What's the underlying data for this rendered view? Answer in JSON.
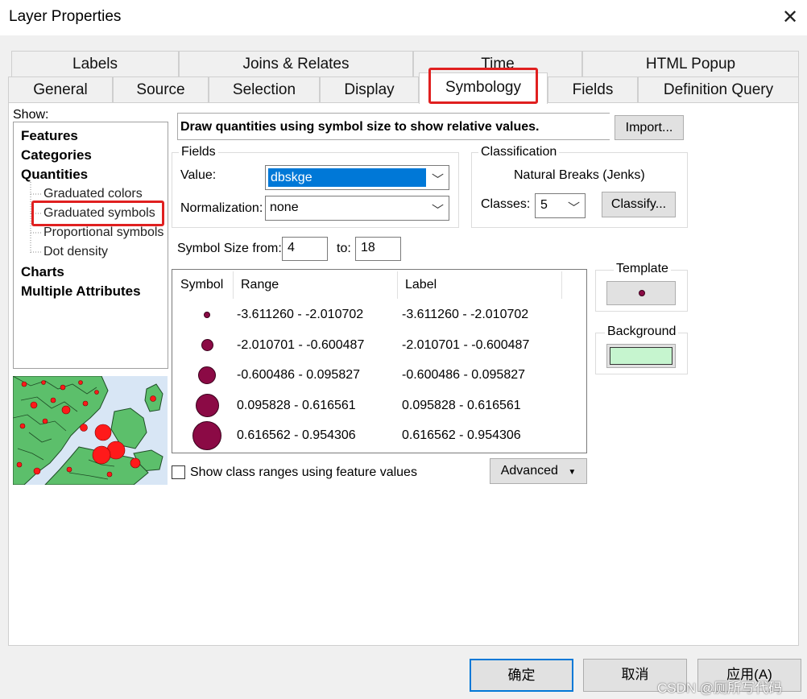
{
  "window": {
    "title": "Layer Properties",
    "close_glyph": "✕"
  },
  "tabs": {
    "row1": [
      "Labels",
      "Joins & Relates",
      "Time",
      "HTML Popup"
    ],
    "row2": [
      "General",
      "Source",
      "Selection",
      "Display",
      "Symbology",
      "Fields",
      "Definition Query"
    ],
    "active": "Symbology"
  },
  "show_panel": {
    "label": "Show:",
    "items": [
      "Features",
      "Categories",
      "Quantities"
    ],
    "sub_items": [
      "Graduated colors",
      "Graduated symbols",
      "Proportional symbols",
      "Dot density"
    ],
    "items_after": [
      "Charts",
      "Multiple Attributes"
    ],
    "selected": "Graduated symbols"
  },
  "description": "Draw quantities using symbol size to show relative values.",
  "import_button": "Import...",
  "fields": {
    "title": "Fields",
    "value_label": "Value:",
    "value": "dbskge",
    "normalization_label": "Normalization:",
    "normalization": "none"
  },
  "classification": {
    "title": "Classification",
    "method": "Natural Breaks (Jenks)",
    "classes_label": "Classes:",
    "classes": "5",
    "classify_button": "Classify..."
  },
  "symbol_size": {
    "from_label": "Symbol Size from:",
    "from": "4",
    "to_label": "to:",
    "to": "18"
  },
  "table": {
    "headers": [
      "Symbol",
      "Range",
      "Label"
    ],
    "rows": [
      {
        "range": "-3.611260 - -2.010702",
        "label": "-3.611260 - -2.010702",
        "size": 4
      },
      {
        "range": "-2.010701 - -0.600487",
        "label": "-2.010701 - -0.600487",
        "size": 7.5
      },
      {
        "range": "-0.600486 - 0.095827",
        "label": "-0.600486 - 0.095827",
        "size": 11
      },
      {
        "range": "0.095828 - 0.616561",
        "label": "0.095828 - 0.616561",
        "size": 14.5
      },
      {
        "range": "0.616562 - 0.954306",
        "label": "0.616562 - 0.954306",
        "size": 18
      }
    ]
  },
  "template": {
    "title": "Template"
  },
  "background": {
    "title": "Background",
    "color": "#c6f5cf"
  },
  "colors": {
    "symbol_fill": "#8b0a45",
    "map_land": "#5cbf6b",
    "map_water": "#d8e6f5",
    "map_dot": "#ff1a1a",
    "highlight": "#e02020"
  },
  "show_class_ranges": {
    "label": "Show class ranges using feature values",
    "checked": false
  },
  "advanced_button": "Advanced",
  "footer": {
    "ok": "确定",
    "cancel": "取消",
    "apply": "应用(A)"
  },
  "watermark": "CSDN @厕所写代码"
}
